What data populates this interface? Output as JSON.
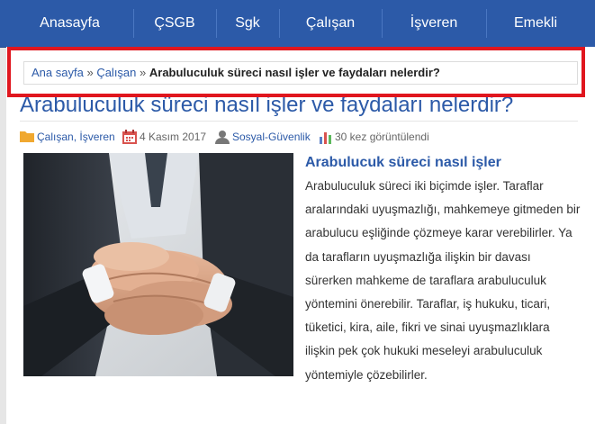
{
  "nav": {
    "items": [
      {
        "label": "Anasayfa"
      },
      {
        "label": "ÇSGB"
      },
      {
        "label": "Sgk"
      },
      {
        "label": "Çalışan"
      },
      {
        "label": "İşveren"
      },
      {
        "label": "Emekli"
      }
    ]
  },
  "breadcrumb": {
    "home": "Ana sayfa",
    "sep": "»",
    "category": "Çalışan",
    "current": "Arabuluculuk süreci nasıl işler ve faydaları nelerdir?"
  },
  "article": {
    "title": "Arabuluculuk süreci nasıl işler ve faydaları nelerdir?",
    "meta": {
      "categories": "Çalışan, İşveren",
      "date": "4 Kasım 2017",
      "author": "Sosyal-Güvenlik",
      "views": "30 kez görüntülendi"
    },
    "subheading": "Arabulucuk süreci nasıl işler",
    "body": "Arabuluculuk süreci iki biçimde işler. Taraflar aralarındaki uyuşmazlığı, mahkemeye gitmeden bir arabulucu eşliğinde çözmeye karar verebilirler. Ya da tarafların uyuşmazlığa ilişkin bir davası sürerken mahkeme de taraflara arabuluculuk yöntemini önerebilir. Taraflar, iş hukuku, ticari, tüketici, kira, aile, fikri ve sinai uyuşmazlıklara ilişkin pek çok hukuki meseleyi arabuluculuk yöntemiyle çözebilirler."
  },
  "colors": {
    "nav_bg": "#2c5aa8",
    "link": "#2c5aa8",
    "highlight": "#e0161e",
    "folder_icon": "#f0a830",
    "calendar_icon": "#d9534f",
    "chart_icon": "#5b7fc7"
  },
  "icons": [
    "folder-icon",
    "calendar-icon",
    "user-icon",
    "bar-chart-icon"
  ]
}
